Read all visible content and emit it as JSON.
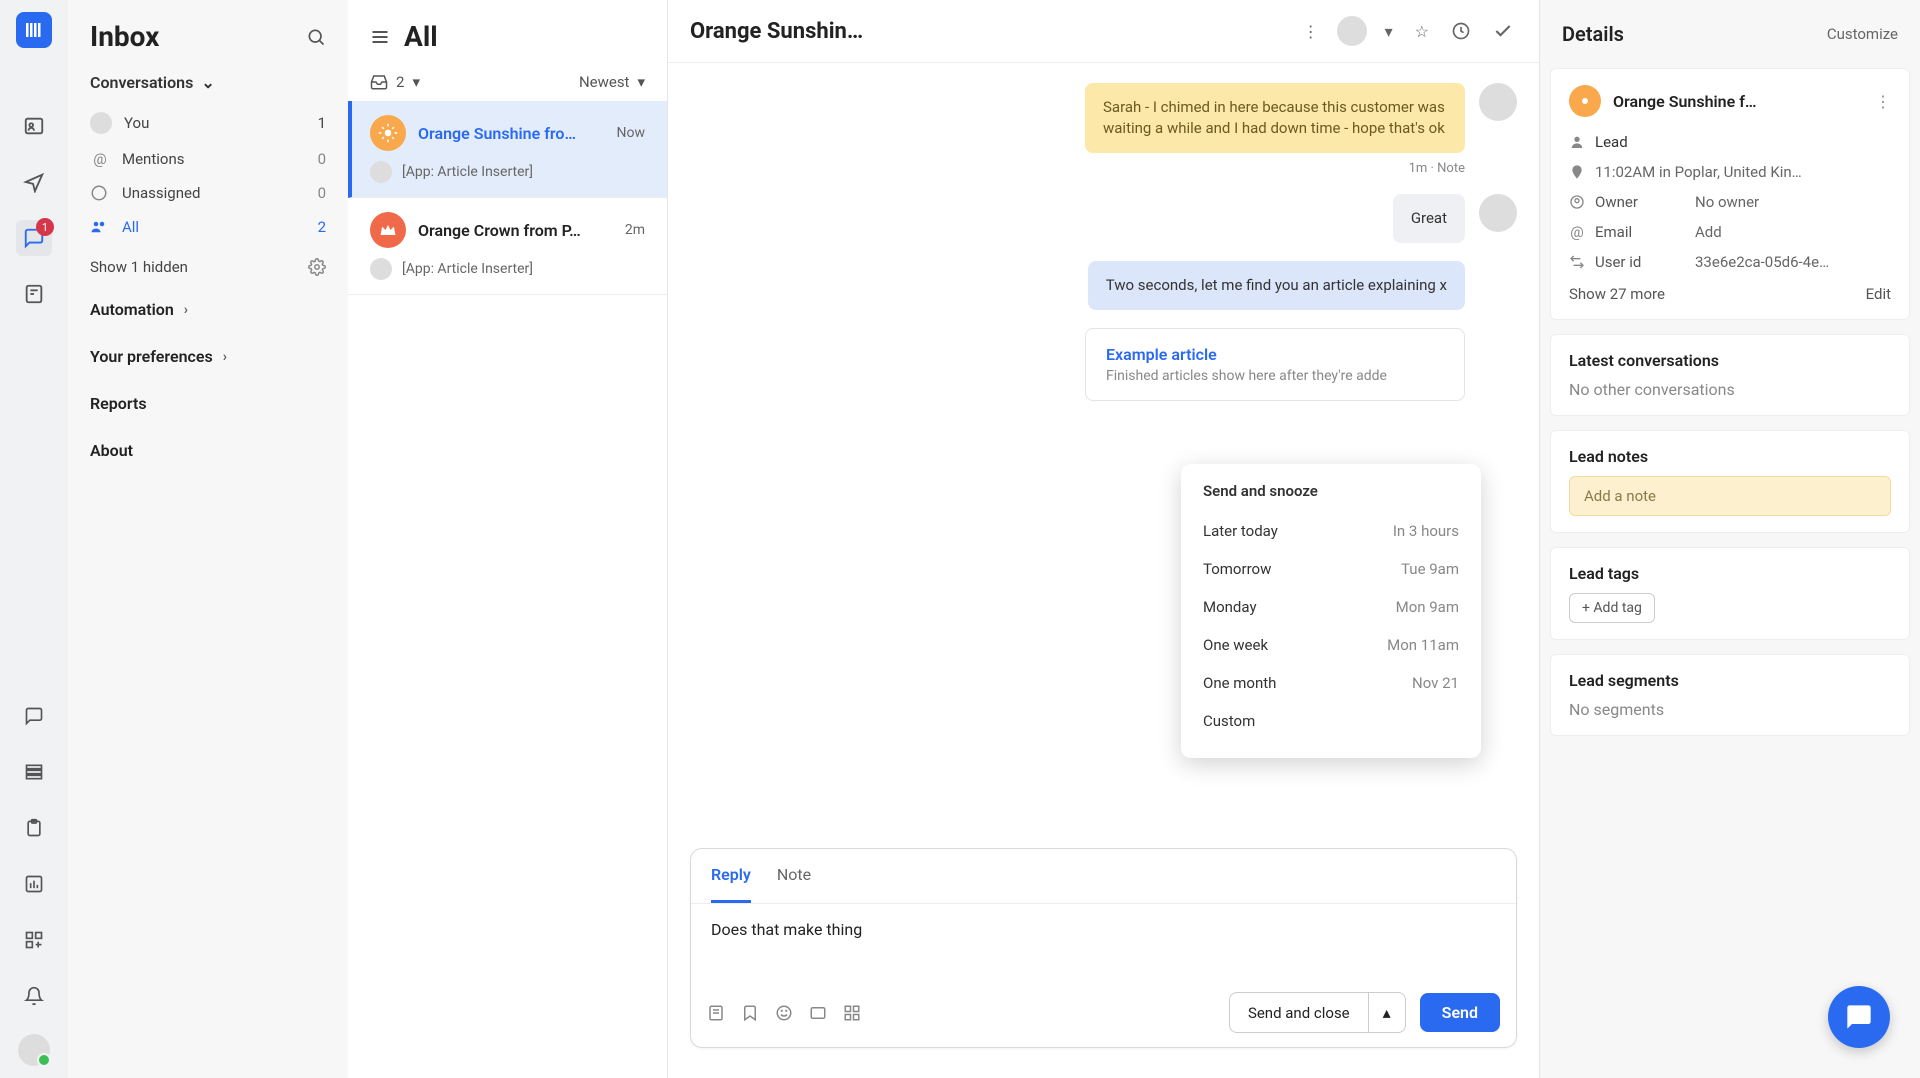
{
  "inbox": {
    "title": "Inbox",
    "conversations_label": "Conversations",
    "items": [
      {
        "icon": "👤",
        "label": "You",
        "count": "1"
      },
      {
        "icon": "@",
        "label": "Mentions",
        "count": "0"
      },
      {
        "icon": "○",
        "label": "Unassigned",
        "count": "0"
      },
      {
        "icon": "👥",
        "label": "All",
        "count": "2"
      }
    ],
    "show_hidden": "Show 1 hidden",
    "sections": [
      "Automation",
      "Your preferences",
      "Reports",
      "About"
    ]
  },
  "list": {
    "title": "All",
    "count": "2",
    "sort": "Newest",
    "items": [
      {
        "name": "Orange Sunshine fro…",
        "time": "Now",
        "sub": "[App: Article Inserter]",
        "color": "#f9a84b",
        "selected": true
      },
      {
        "name": "Orange Crown from P…",
        "time": "2m",
        "sub": "[App: Article Inserter]",
        "color": "#f06a4a",
        "selected": false
      }
    ]
  },
  "chat": {
    "title": "Orange Sunshin…",
    "messages": {
      "note": "Sarah - I chimed in here because this customer was waiting a while and I had down time - hope that's ok",
      "note_meta": "1m · Note",
      "great": "Great",
      "two_sec": "Two seconds, let me find you an article explaining x",
      "article_title": "Example article",
      "article_desc": "Finished articles show here after they're adde"
    },
    "tabs": {
      "reply": "Reply",
      "note": "Note"
    },
    "draft": "Does that make thing",
    "send_close": "Send and close",
    "send": "Send"
  },
  "snooze": {
    "head": "Send and snooze",
    "items": [
      {
        "label": "Later today",
        "time": "In 3 hours"
      },
      {
        "label": "Tomorrow",
        "time": "Tue 9am"
      },
      {
        "label": "Monday",
        "time": "Mon 9am"
      },
      {
        "label": "One week",
        "time": "Mon 11am"
      },
      {
        "label": "One month",
        "time": "Nov 21"
      },
      {
        "label": "Custom",
        "time": ""
      }
    ]
  },
  "details": {
    "title": "Details",
    "customize": "Customize",
    "name": "Orange Sunshine f…",
    "lead": "Lead",
    "time": "11:02AM in Poplar, United Kin…",
    "owner_k": "Owner",
    "owner_v": "No owner",
    "email_k": "Email",
    "email_v": "Add",
    "uid_k": "User id",
    "uid_v": "33e6e2ca-05d6-4e…",
    "show_more": "Show 27 more",
    "edit": "Edit",
    "latest_h": "Latest conversations",
    "latest_v": "No other conversations",
    "notes_h": "Lead notes",
    "notes_ph": "Add a note",
    "tags_h": "Lead tags",
    "add_tag": "+ Add tag",
    "seg_h": "Lead segments",
    "seg_v": "No segments"
  },
  "nav_badge": "1"
}
